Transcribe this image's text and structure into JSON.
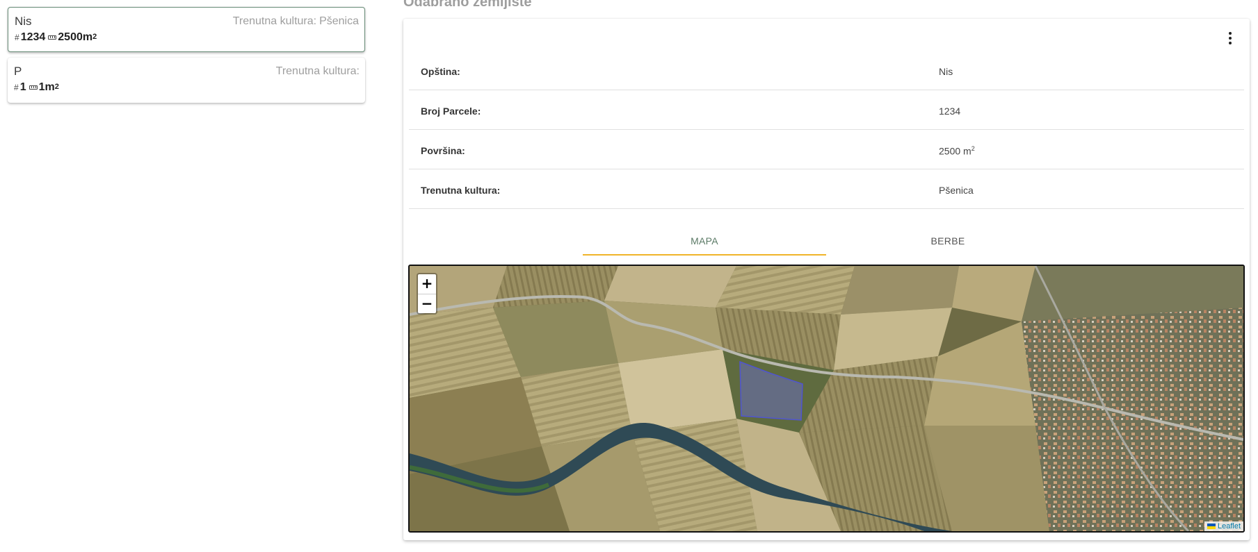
{
  "parcels": [
    {
      "name": "Nis",
      "culture_label": "Trenutna kultura:",
      "culture_value": "Pšenica",
      "number": "1234",
      "area": "2500",
      "area_unit": "m",
      "area_exp": "2",
      "selected": true
    },
    {
      "name": "P",
      "culture_label": "Trenutna kultura:",
      "culture_value": "",
      "number": "1",
      "area": "1",
      "area_unit": "m",
      "area_exp": "2",
      "selected": false
    }
  ],
  "detail": {
    "heading": "Odabrano zemljište",
    "rows": [
      {
        "label": "Opština:",
        "value": "Nis"
      },
      {
        "label": "Broj Parcele:",
        "value": "1234"
      },
      {
        "label": "Površina:",
        "value": "2500 m",
        "sup": "2"
      },
      {
        "label": "Trenutna kultura:",
        "value": "Pšenica"
      }
    ],
    "tabs": [
      {
        "label": "MAPA",
        "active": true
      },
      {
        "label": "BERBE",
        "active": false
      }
    ]
  },
  "map": {
    "zoom_in": "+",
    "zoom_out": "−",
    "attribution": "Leaflet",
    "polygon_color": "#6b6fd6"
  },
  "icons": {
    "number": "hash-icon",
    "area": "ruler-icon",
    "menu": "more-vert-icon",
    "attribution": "flag-icon"
  },
  "colors": {
    "selected_border": "#6b8f7a",
    "tab_active_text": "#5b7a66",
    "tab_indicator": "#f0b429"
  }
}
